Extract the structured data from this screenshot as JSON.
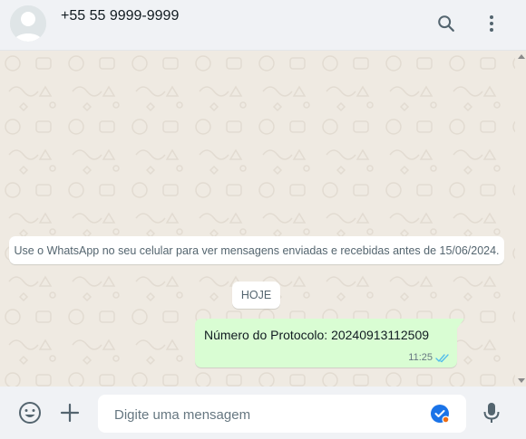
{
  "header": {
    "contact_name": "+55 55 9999-9999",
    "icons": {
      "avatar": "default-avatar",
      "search": "search-icon",
      "menu": "kebab-menu-icon"
    }
  },
  "chat": {
    "system_message": "Use o WhatsApp no seu celular para ver mensagens enviadas e recebidas antes de 15/06/2024.",
    "date_label": "HOJE",
    "messages": [
      {
        "direction": "outgoing",
        "text": "Número do Protocolo: 20240913112509",
        "time": "11:25",
        "status": "read"
      }
    ]
  },
  "composer": {
    "placeholder": "Digite uma mensagem",
    "icons": {
      "emoji": "emoji-icon",
      "attach": "plus-icon",
      "mic": "microphone-icon",
      "extension": "grammarly-check-icon"
    }
  },
  "colors": {
    "header_bg": "#f0f2f5",
    "chat_bg": "#efeae2",
    "outgoing_bubble": "#d9fdd3",
    "read_ticks": "#53bdeb",
    "icon_gray": "#54656f"
  }
}
